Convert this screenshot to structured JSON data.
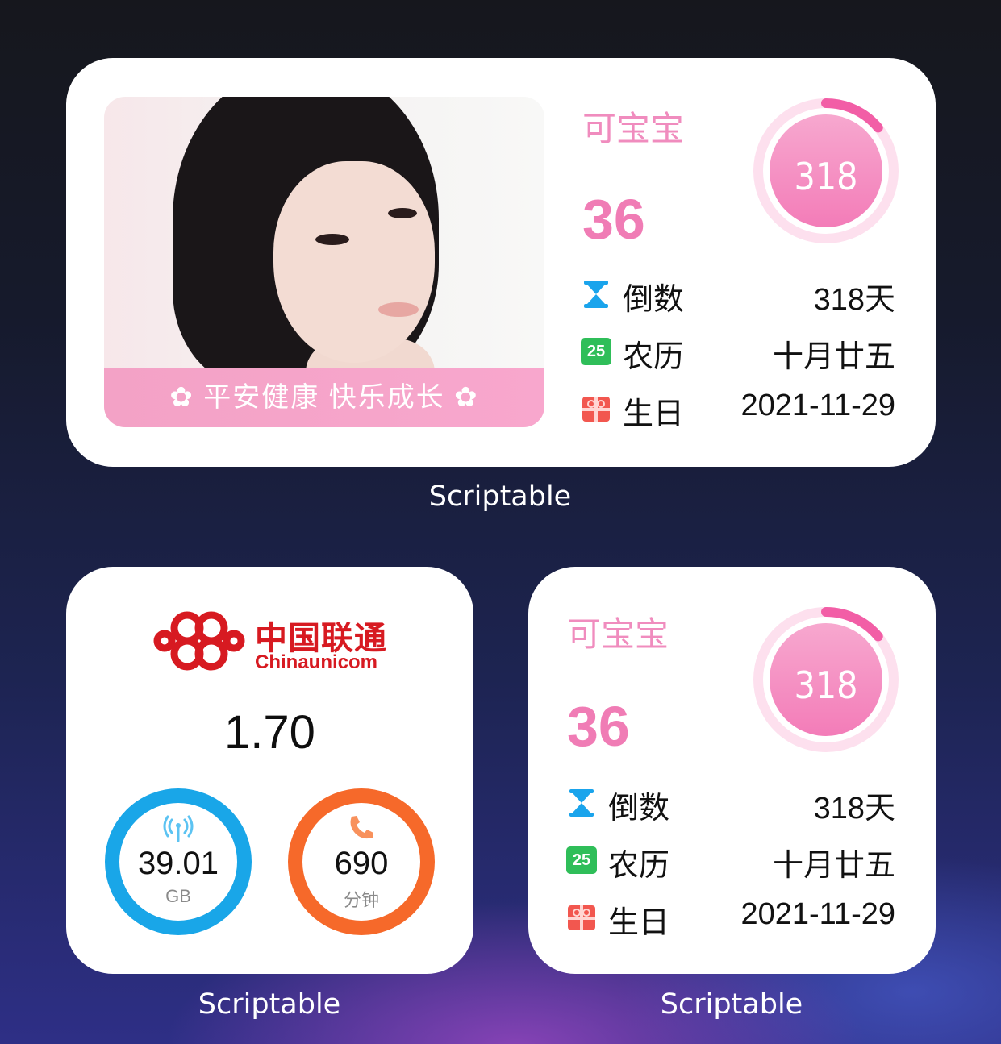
{
  "medium_widget": {
    "banner_text": "✿ 平安健康  快乐成长 ✿",
    "name": "可宝宝",
    "age": "36",
    "ring_number": "318",
    "ring_progress": 0.14,
    "rows": [
      {
        "icon": "hourglass-icon",
        "label": "倒数",
        "value": "318天"
      },
      {
        "icon": "calendar-icon",
        "icon_text": "25",
        "label": "农历",
        "value": "十月廿五"
      },
      {
        "icon": "gift-icon",
        "label": "生日",
        "value": "2021-11-29"
      }
    ],
    "caption": "Scriptable"
  },
  "unicom_widget": {
    "logo_name": "中国联通",
    "logo_en": "Chinaunicom",
    "balance": "1.70",
    "data_gauge": {
      "value": "39.01",
      "unit": "GB",
      "icon": "signal-icon",
      "color": "#19a6e8"
    },
    "voice_gauge": {
      "value": "690",
      "unit": "分钟",
      "icon": "phone-icon",
      "color": "#f6692a"
    },
    "caption": "Scriptable"
  },
  "small_widget": {
    "name": "可宝宝",
    "age": "36",
    "ring_number": "318",
    "ring_progress": 0.14,
    "rows": [
      {
        "icon": "hourglass-icon",
        "label": "倒数",
        "value": "318天"
      },
      {
        "icon": "calendar-icon",
        "icon_text": "25",
        "label": "农历",
        "value": "十月廿五"
      },
      {
        "icon": "gift-icon",
        "label": "生日",
        "value": "2021-11-29"
      }
    ],
    "caption": "Scriptable"
  },
  "colors": {
    "accent_pink": "#f07cb5",
    "unicom_red": "#d71a21",
    "data_blue": "#19a6e8",
    "voice_orange": "#f6692a"
  }
}
